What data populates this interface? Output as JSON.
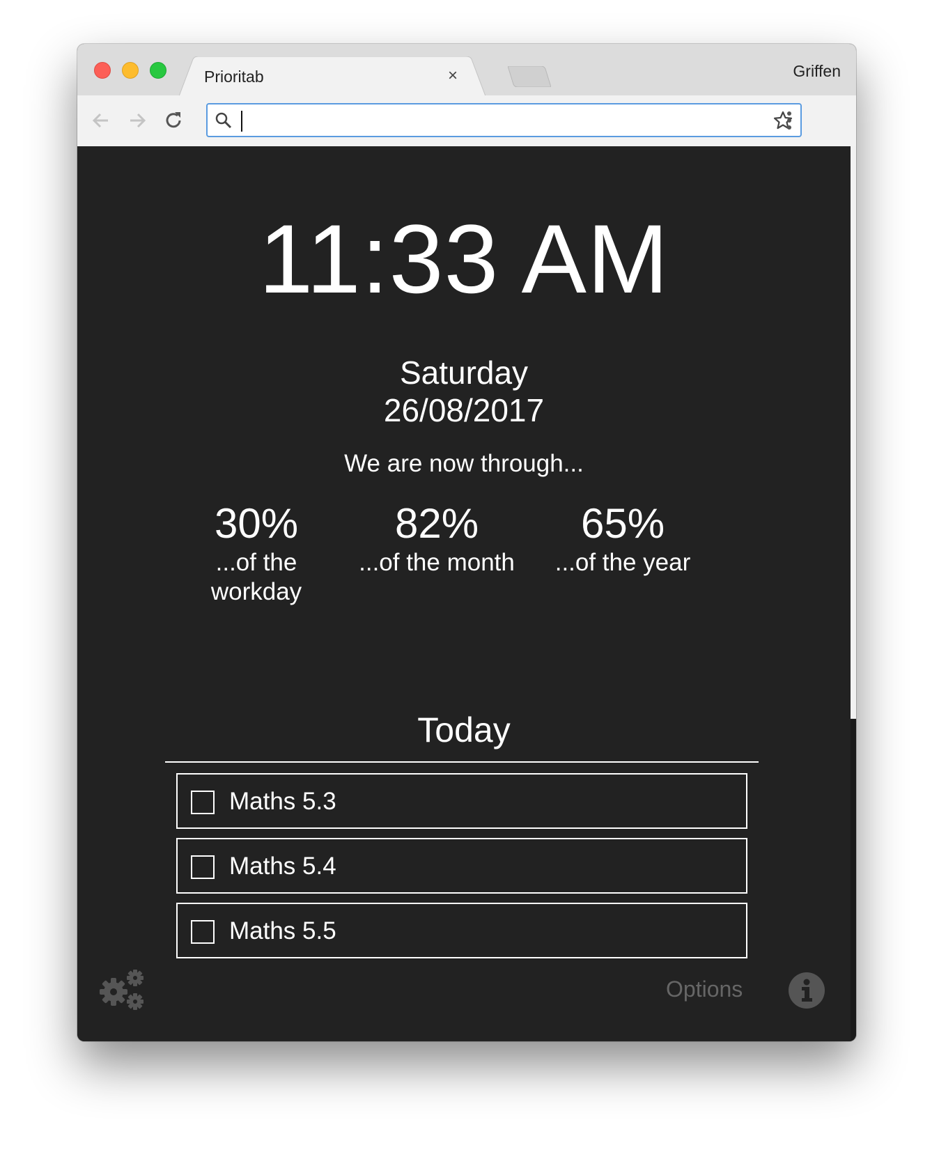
{
  "browser": {
    "tab_title": "Prioritab",
    "tab_close": "×",
    "profile_name": "Griffen",
    "omnibox_value": ""
  },
  "clock": {
    "time": "11:33 AM",
    "day": "Saturday",
    "date": "26/08/2017"
  },
  "progress": {
    "intro": "We are now through...",
    "stats": [
      {
        "percent": "30%",
        "label": "...of the workday"
      },
      {
        "percent": "82%",
        "label": "...of the month"
      },
      {
        "percent": "65%",
        "label": "...of the year"
      }
    ]
  },
  "today": {
    "heading": "Today",
    "tasks": [
      {
        "label": "Maths 5.3",
        "done": false
      },
      {
        "label": "Maths 5.4",
        "done": false
      },
      {
        "label": "Maths 5.5",
        "done": false
      }
    ]
  },
  "footer": {
    "options_label": "Options"
  },
  "colors": {
    "background": "#222222",
    "text": "#ffffff",
    "muted": "#666666",
    "omnibox_focus": "#5a9be0"
  }
}
